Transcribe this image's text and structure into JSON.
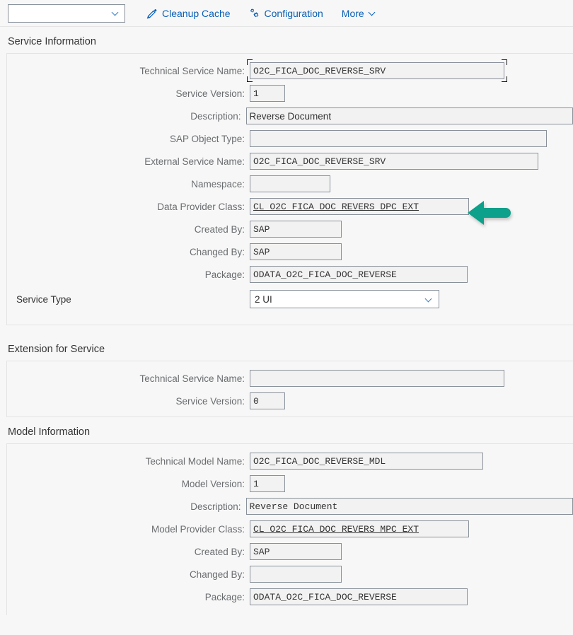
{
  "toolbar": {
    "dropdown_value": "",
    "dropdown_icon": "chevron-down-icon",
    "buttons": [
      {
        "label": "Cleanup Cache",
        "icon": "pencil-icon"
      },
      {
        "label": "Configuration",
        "icon": "gears-icon"
      },
      {
        "label": "More",
        "icon": "chevron-down-icon"
      }
    ]
  },
  "sections": {
    "service_information": {
      "title": "Service Information",
      "fields": {
        "technical_service_name": {
          "label": "Technical Service Name:",
          "value": "O2C_FICA_DOC_REVERSE_SRV"
        },
        "service_version": {
          "label": "Service Version:",
          "value": "1"
        },
        "description": {
          "label": "Description:",
          "value": "Reverse Document"
        },
        "sap_object_type": {
          "label": "SAP Object Type:",
          "value": ""
        },
        "external_service_name": {
          "label": "External Service Name:",
          "value": "O2C_FICA_DOC_REVERSE_SRV"
        },
        "namespace": {
          "label": "Namespace:",
          "value": ""
        },
        "data_provider_class": {
          "label": "Data Provider Class:",
          "value": "CL_O2C_FICA_DOC_REVERS_DPC_EXT"
        },
        "created_by": {
          "label": "Created By:",
          "value": "SAP"
        },
        "changed_by": {
          "label": "Changed By:",
          "value": "SAP"
        },
        "package": {
          "label": "Package:",
          "value": "ODATA_O2C_FICA_DOC_REVERSE"
        },
        "service_type": {
          "label": "Service Type",
          "value": "2 UI",
          "icon": "chevron-down-icon"
        }
      }
    },
    "extension_for_service": {
      "title": "Extension for Service",
      "fields": {
        "technical_service_name": {
          "label": "Technical Service Name:",
          "value": ""
        },
        "service_version": {
          "label": "Service Version:",
          "value": "0"
        }
      }
    },
    "model_information": {
      "title": "Model Information",
      "fields": {
        "technical_model_name": {
          "label": "Technical Model Name:",
          "value": "O2C_FICA_DOC_REVERSE_MDL"
        },
        "model_version": {
          "label": "Model Version:",
          "value": "1"
        },
        "description": {
          "label": "Description:",
          "value": "Reverse Document"
        },
        "model_provider_class": {
          "label": "Model Provider Class:",
          "value": "CL_O2C_FICA_DOC_REVERS_MPC_EXT"
        },
        "created_by": {
          "label": "Created By:",
          "value": "SAP"
        },
        "changed_by": {
          "label": "Changed By:",
          "value": ""
        },
        "package": {
          "label": "Package:",
          "value": "ODATA_O2C_FICA_DOC_REVERSE"
        }
      }
    }
  },
  "annotation": {
    "arrow": {
      "name": "highlight-arrow",
      "color": "#11A08A",
      "points_to": "data_provider_class"
    }
  },
  "colors": {
    "link": "#0a5fb4",
    "accent": "#11A08A",
    "label": "#6a6d70",
    "field_border": "#89919a",
    "panel_bg": "#f7f7f7"
  }
}
